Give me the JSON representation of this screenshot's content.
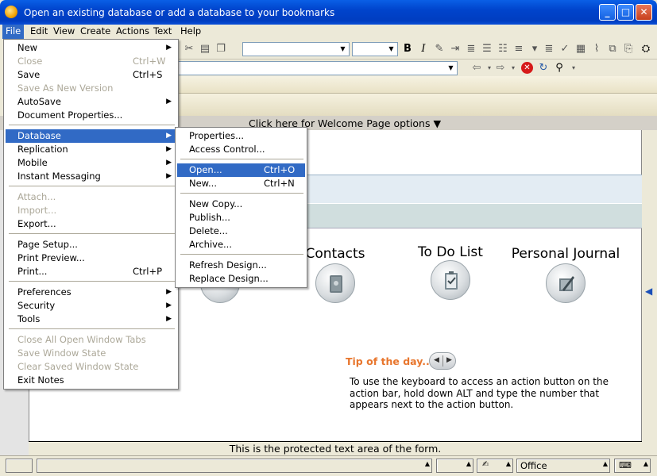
{
  "window": {
    "title": "Open an existing database or add a database to your bookmarks",
    "minimize_icon": "minimize-icon",
    "maximize_icon": "maximize-icon",
    "close_icon": "close-icon"
  },
  "menubar": {
    "items": [
      "File",
      "Edit",
      "View",
      "Create",
      "Actions",
      "Text",
      "Help"
    ]
  },
  "file_menu": {
    "items": [
      {
        "label": "New",
        "shortcut": "",
        "submenu": true,
        "disabled": false
      },
      {
        "label": "Close",
        "shortcut": "Ctrl+W",
        "submenu": false,
        "disabled": true
      },
      {
        "label": "Save",
        "shortcut": "Ctrl+S",
        "submenu": false,
        "disabled": false
      },
      {
        "label": "Save As New Version",
        "shortcut": "",
        "submenu": false,
        "disabled": true
      },
      {
        "label": "AutoSave",
        "shortcut": "",
        "submenu": true,
        "disabled": false
      },
      {
        "label": "Document Properties...",
        "shortcut": "",
        "submenu": false,
        "disabled": false
      },
      {
        "label": "Database",
        "shortcut": "",
        "submenu": true,
        "disabled": false,
        "highlighted": true
      },
      {
        "label": "Replication",
        "shortcut": "",
        "submenu": true,
        "disabled": false
      },
      {
        "label": "Mobile",
        "shortcut": "",
        "submenu": true,
        "disabled": false
      },
      {
        "label": "Instant Messaging",
        "shortcut": "",
        "submenu": true,
        "disabled": false
      },
      {
        "label": "Attach...",
        "shortcut": "",
        "submenu": false,
        "disabled": true
      },
      {
        "label": "Import...",
        "shortcut": "",
        "submenu": false,
        "disabled": true
      },
      {
        "label": "Export...",
        "shortcut": "",
        "submenu": false,
        "disabled": false
      },
      {
        "label": "Page Setup...",
        "shortcut": "",
        "submenu": false,
        "disabled": false
      },
      {
        "label": "Print Preview...",
        "shortcut": "",
        "submenu": false,
        "disabled": false
      },
      {
        "label": "Print...",
        "shortcut": "Ctrl+P",
        "submenu": false,
        "disabled": false
      },
      {
        "label": "Preferences",
        "shortcut": "",
        "submenu": true,
        "disabled": false
      },
      {
        "label": "Security",
        "shortcut": "",
        "submenu": true,
        "disabled": false
      },
      {
        "label": "Tools",
        "shortcut": "",
        "submenu": true,
        "disabled": false
      },
      {
        "label": "Close All Open Window Tabs",
        "shortcut": "",
        "submenu": false,
        "disabled": true
      },
      {
        "label": "Save Window State",
        "shortcut": "",
        "submenu": false,
        "disabled": true
      },
      {
        "label": "Clear Saved Window State",
        "shortcut": "",
        "submenu": false,
        "disabled": true
      },
      {
        "label": "Exit Notes",
        "shortcut": "",
        "submenu": false,
        "disabled": false
      }
    ]
  },
  "database_submenu": {
    "items": [
      {
        "label": "Properties...",
        "shortcut": ""
      },
      {
        "label": "Access Control...",
        "shortcut": ""
      },
      {
        "label": "Open...",
        "shortcut": "Ctrl+O",
        "highlighted": true
      },
      {
        "label": "New...",
        "shortcut": "Ctrl+N"
      },
      {
        "label": "New Copy...",
        "shortcut": ""
      },
      {
        "label": "Publish...",
        "shortcut": ""
      },
      {
        "label": "Delete...",
        "shortcut": ""
      },
      {
        "label": "Archive...",
        "shortcut": ""
      },
      {
        "label": "Refresh Design...",
        "shortcut": ""
      },
      {
        "label": "Replace Design...",
        "shortcut": ""
      }
    ]
  },
  "welcome": {
    "options_text": "Click here for Welcome Page options",
    "tiles": [
      {
        "title": "Contacts",
        "icon": "contacts-book-icon"
      },
      {
        "title": "To Do List",
        "icon": "todo-clipboard-icon"
      },
      {
        "title": "Personal Journal",
        "icon": "journal-pen-icon"
      }
    ],
    "tip_title": "Tip of the day...",
    "tip_text": "To use the keyboard to access an action button on the action bar, hold down ALT and type the number that appears next to the action button.",
    "protected_text": "This is the protected text area of the form."
  },
  "statusbar": {
    "location": "Office"
  },
  "colors": {
    "titlebar": "#0044cc",
    "menu_highlight": "#316ac5",
    "tip_orange": "#e8762d"
  }
}
